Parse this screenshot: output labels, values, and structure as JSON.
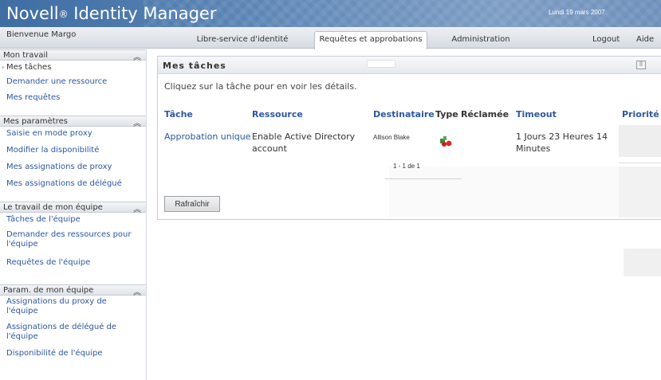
{
  "header": {
    "app_title": "Novell",
    "app_title_reg": "®",
    "app_title_rest": " Identity Manager",
    "date": "Lundi 19 mars 2007"
  },
  "navbar": {
    "welcome": "Bienvenue Margo",
    "tabs": [
      {
        "label": "Libre-service d'identité"
      },
      {
        "label": "Requêtes et approbations"
      },
      {
        "label": "Administration"
      }
    ],
    "logout": "Logout",
    "help": "Aide"
  },
  "sidebar": {
    "sections": [
      {
        "title": "Mon travail",
        "items": [
          "Mes tâches",
          "Demander une ressource",
          "Mes requêtes"
        ]
      },
      {
        "title": "Mes paramètres",
        "items": [
          "Saisie en mode proxy",
          "Modifier la disponibilité",
          "Mes assignations de proxy",
          "Mes assignations de délégué"
        ]
      },
      {
        "title": "Le travail de mon équipe",
        "items": [
          "Tâches de l'équipe",
          "Demander des ressources pour l'équipe",
          "Requêtes de l'équipe"
        ]
      },
      {
        "title": "Param. de mon équipe",
        "items": [
          "Assignations du proxy de l'équipe",
          "Assignations de délégué de l'équipe",
          "Disponibilité de l'équipe"
        ]
      }
    ],
    "collapse_glyph": "≈"
  },
  "panel": {
    "title": "Mes tâches",
    "instruction": "Cliquez sur la tâche pour en voir les détails.",
    "columns": [
      "Tâche",
      "Ressource",
      "Destinataire",
      "Type",
      "Réclamée",
      "Timeout",
      "Priorité"
    ],
    "row": {
      "task": "Approbation unique",
      "resource_line1": "Enable Active Directory",
      "resource_line2": "account",
      "recipient": "Allison Blake",
      "type_icon": "approval-icon",
      "timeout_line1": "1 Jours 23 Heures 14",
      "timeout_line2": "Minutes"
    },
    "pagination": "1 - 1 de 1",
    "refresh_label": "Rafraîchir",
    "menu_icon": "panel-menu-icon"
  },
  "colors": {
    "link": "#2d57a0",
    "banner": "#4f78ab"
  }
}
